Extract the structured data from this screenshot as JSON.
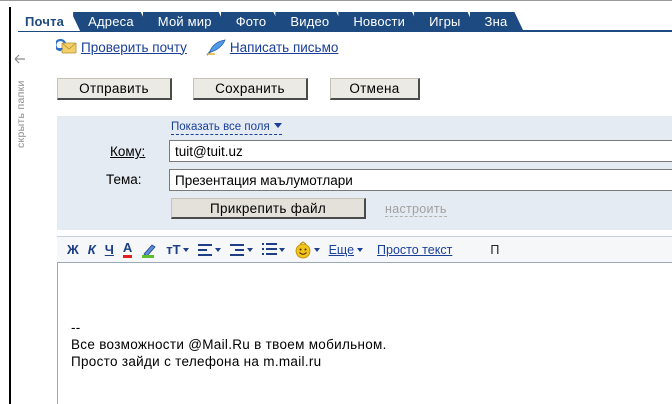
{
  "tabs": [
    {
      "label": "Почта",
      "active": true
    },
    {
      "label": "Адреса",
      "active": false
    },
    {
      "label": "Мой мир",
      "active": false
    },
    {
      "label": "Фото",
      "active": false
    },
    {
      "label": "Видео",
      "active": false
    },
    {
      "label": "Новости",
      "active": false
    },
    {
      "label": "Игры",
      "active": false
    },
    {
      "label": "Зна",
      "active": false
    }
  ],
  "sidebar": {
    "hide_folders": "скрыть папки",
    "arrow_icon": "arrow-left-icon"
  },
  "links": {
    "check_mail": "Проверить почту",
    "check_mail_icon": "refresh-mail-icon",
    "write_letter": "Написать письмо",
    "write_letter_icon": "feather-pen-icon"
  },
  "actions": {
    "send": "Отправить",
    "save": "Сохранить",
    "cancel": "Отмена"
  },
  "form": {
    "show_all_fields": "Показать все поля",
    "to_label": "Кому:",
    "to_value": "tuit@tuit.uz",
    "subject_label": "Тема:",
    "subject_value": "Презентация маълумотлари",
    "attach_button": "Прикрепить файл",
    "configure_link": "настроить"
  },
  "toolbar": {
    "bold": "Ж",
    "italic": "К",
    "underline": "Ч",
    "font_color": "А",
    "font_size": "тТ",
    "more": "Еще",
    "plain_text": "Просто текст",
    "cut_label": "П"
  },
  "editor": {
    "lines": [
      "--",
      "Все возможности @Mail.Ru в твоем мобильном.",
      "Просто зайди с телефона на m.mail.ru"
    ]
  },
  "colors": {
    "tab_bg": "#1d4a80",
    "link": "#1a3f9a",
    "panel_bg": "#e4ebf2",
    "button_bg": "#eceae4"
  }
}
